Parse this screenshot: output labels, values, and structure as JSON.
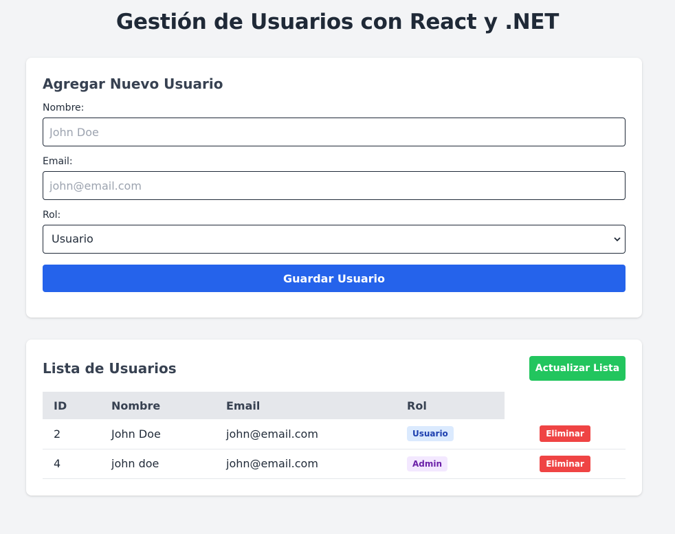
{
  "page": {
    "title": "Gestión de Usuarios con React y .NET"
  },
  "form": {
    "title": "Agregar Nuevo Usuario",
    "name_label": "Nombre:",
    "name_placeholder": "John Doe",
    "email_label": "Email:",
    "email_placeholder": "john@email.com",
    "role_label": "Rol:",
    "role_selected": "Usuario",
    "save_label": "Guardar Usuario"
  },
  "list": {
    "title": "Lista de Usuarios",
    "refresh_label": "Actualizar Lista",
    "columns": [
      "ID",
      "Nombre",
      "Email",
      "Rol"
    ],
    "rows": [
      {
        "id": "2",
        "name": "John Doe",
        "email": "john@email.com",
        "role": "Usuario",
        "action": "Eliminar"
      },
      {
        "id": "4",
        "name": "john doe",
        "email": "john@email.com",
        "role": "Admin",
        "action": "Eliminar"
      }
    ]
  },
  "colors": {
    "primary": "#2563eb",
    "success": "#22c55e",
    "danger": "#ef4444",
    "badge_usuario_bg": "#dbeafe",
    "badge_admin_bg": "#f3e8ff"
  }
}
